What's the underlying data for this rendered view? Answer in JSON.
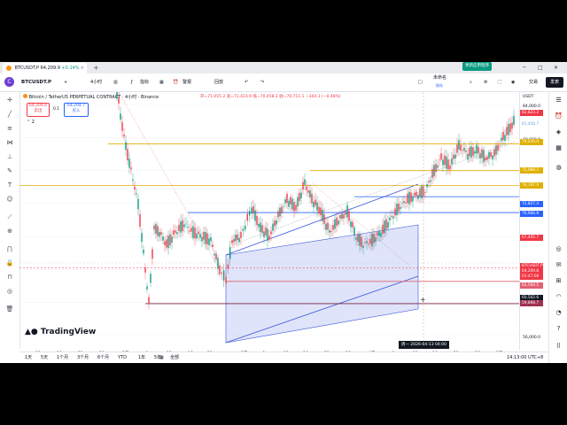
{
  "tab": {
    "symbol": "BTCUSDT.P",
    "price": "64,209.9",
    "change": "+0.14%",
    "close": "×",
    "new_tab": "+"
  },
  "window": {
    "minimize": "─",
    "maximize": "□",
    "close": "✕",
    "update_button": "更新应用程序"
  },
  "toolbar": {
    "symbol": "BTCUSDT.P",
    "interval": "4小时",
    "indicators": "指标",
    "alert": "警报",
    "replay": "回放",
    "save_label": "未命名",
    "save_sub": "保存",
    "trade": "交易",
    "publish": "发表"
  },
  "legend": {
    "title": "Bitcoin / TetherUS PERPETUAL CONTRACT · 4小时 · Binance",
    "ohlc": "开=71,055.2  高=71,423.9  低=70,458.2  收=70,711.1  −344.1 (−0.48%)",
    "sell_price": "64,204.6",
    "sell_label": "卖出",
    "spread": "0.1",
    "buy_price": "64,204.7",
    "buy_label": "买入",
    "collapse": "⌃ 2"
  },
  "price_axis": {
    "currency": "USDT",
    "ticks": [
      "84,000.0",
      "80,000.0",
      "76,000.0",
      "72,000.0",
      "68,000.0",
      "64,000.0",
      "60,000.0",
      "56,000.0"
    ],
    "labels": [
      {
        "text": "82,823.2",
        "color": "#f23645"
      },
      {
        "text": "81,458.7",
        "color": "#6fa8dc"
      },
      {
        "text": "79,220.0",
        "color": "#e0b000"
      },
      {
        "text": "75,988.2",
        "color": "#e0b000"
      },
      {
        "text": "74,197.0",
        "color": "#e0b000"
      },
      {
        "text": "72,827.4",
        "color": "#2962ff"
      },
      {
        "text": "70,906.8",
        "color": "#2962ff"
      },
      {
        "text": "67,405.7",
        "color": "#f23645"
      },
      {
        "text": "BTCUSDT.P",
        "color": "#f23645"
      },
      {
        "text": "64,209.8",
        "color": "#f23645"
      },
      {
        "text": "01:47:00",
        "color": "#f23645"
      },
      {
        "text": "62,564.5",
        "color": "#e06070"
      },
      {
        "text": "60,502.6",
        "color": "#131722"
      },
      {
        "text": "59,868.7",
        "color": "#a03050"
      }
    ]
  },
  "time_axis": {
    "ticks": [
      "11",
      "16",
      "21",
      "26",
      "2月",
      "6",
      "11",
      "16",
      "21",
      "3月",
      "6",
      "11",
      "16",
      "21",
      "26",
      "4月",
      "6",
      "11",
      "16",
      "21",
      "26",
      "5月"
    ],
    "crosshair_label": "周一 2026-04-13  04:00"
  },
  "bottom_bar": {
    "ranges": [
      "1天",
      "5天",
      "1个月",
      "3个月",
      "6个月",
      "YTD",
      "1年",
      "5年",
      "全部"
    ],
    "calendar": "▦",
    "time": "14:13:00 UTC+8"
  },
  "brand": "TradingView",
  "colors": {
    "up": "#089981",
    "down": "#f23645",
    "accent": "#2962ff",
    "channel": "#c5cdf5"
  }
}
